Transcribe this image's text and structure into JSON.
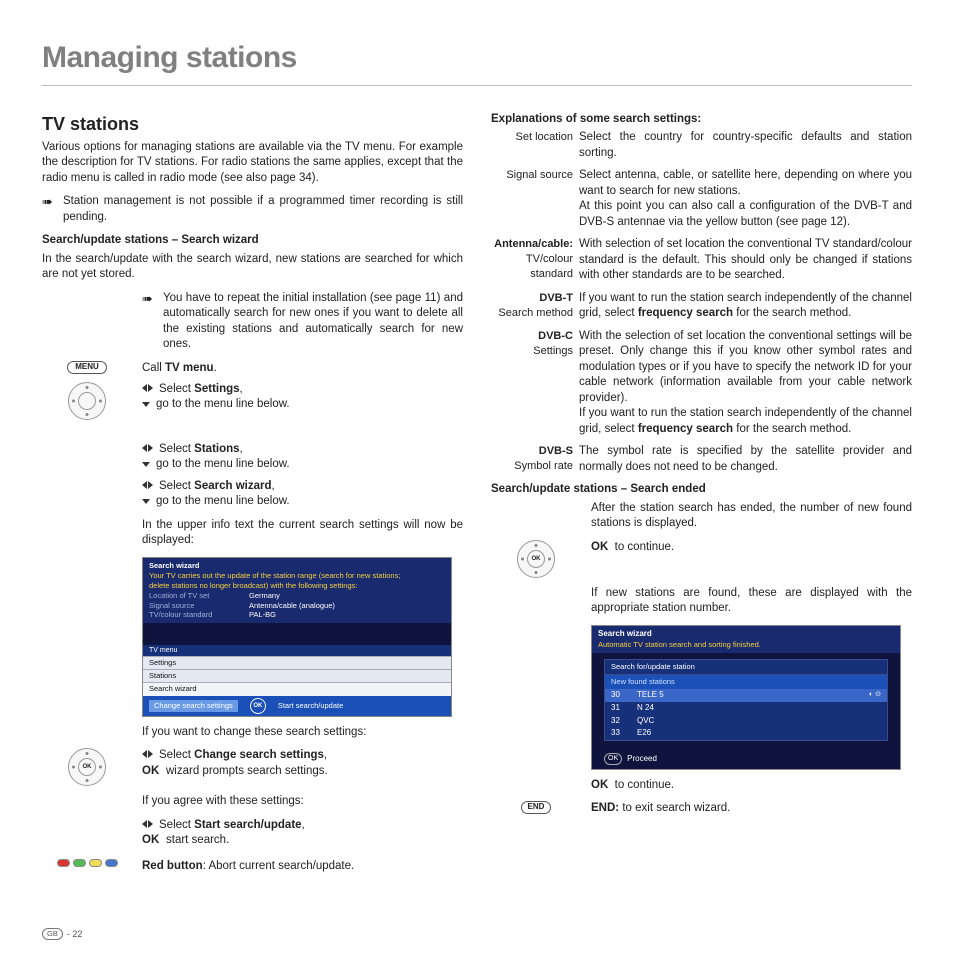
{
  "page": {
    "title": "Managing stations",
    "footer_region": "GB",
    "footer_page": "- 22"
  },
  "left": {
    "h2": "TV stations",
    "intro": "Various options for managing stations are available via the TV menu. For example the description for TV stations. For radio stations the same applies, except that the radio menu is called in radio mode (see also page 34).",
    "note1": "Station management is not possible if a programmed timer recording is still pending.",
    "sub1": "Search/update stations  – Search wizard",
    "sub1_desc": "In the search/update with the search wizard, new stations are searched for which are not yet stored.",
    "note2": "You have to repeat the initial installation (see page 11) and automatically search for new ones if you want to delete all the existing stations and automatically search for new ones.",
    "menu_label": "MENU",
    "call_tv": "Call TV menu.",
    "tv_menu_bold": "TV menu",
    "step1a": "Select Settings,",
    "step1a_bold": "Settings",
    "step_go": "go to the menu line below.",
    "step2a": "Select Stations,",
    "step2a_bold": "Stations",
    "step3a": "Select Search wizard,",
    "step3a_bold": "Search wizard",
    "upper_info": "In the upper info text the current search settings will now be displayed:",
    "screenshot1": {
      "title": "Search wizard",
      "line1": "Your TV carries out the update of the station range (search for new stations;",
      "line2": "delete stations no longer broadcast) with the following settings:",
      "r1_lbl": "Location of TV set",
      "r1_val": "Germany",
      "r2_lbl": "Signal source",
      "r2_val": "Antenna/cable (analogue)",
      "r3_lbl": "TV/colour standard",
      "r3_val": "PAL-BG",
      "menu_head": "TV menu",
      "menu1": "Settings",
      "menu2": "Stations",
      "menu3": "Search wizard",
      "action1": "Change search settings",
      "action2": "Start search/update"
    },
    "if_change": "If you want to change these search settings:",
    "step_change": "Select Change search settings,",
    "step_change_bold": "Change search settings",
    "ok_prompts": "wizard prompts search settings.",
    "ok_label": "OK",
    "if_agree": "If you agree with these settings:",
    "step_start": "Select Start search/update,",
    "step_start_bold": "Start search/update",
    "ok_start": "start search.",
    "red_btn": "Red button",
    "red_desc": ": Abort current search/update."
  },
  "right": {
    "sub1": "Explanations of some search settings:",
    "defs": [
      {
        "term1": "Set location",
        "desc": "Select the country for country-specific defaults and station sorting."
      },
      {
        "term1": "Signal source",
        "desc": "Select antenna, cable, or satellite here, depending on where you want to search for new stations.\nAt this point you can also call a configuration of the DVB-T and DVB-S antennae via the yellow button (see page 12)."
      },
      {
        "term1": "Antenna/cable:",
        "term2": "TV/colour",
        "term3": "standard",
        "desc": "With selection of set location the conventional TV standard/colour standard is the default. This should only be changed if stations with other standards are to be searched."
      },
      {
        "term1": "DVB-T",
        "term2": "Search method",
        "desc": "If you want to run the station search independently of the channel grid, select frequency search for the search method.",
        "bold_in_desc": "frequency search"
      },
      {
        "term1": "DVB-C",
        "term2": "Settings",
        "desc": "With the selection of set location the conventional settings will be preset. Only change this if you know other symbol rates and modulation types or if you have to specify the network ID for your cable network (information available from your cable network provider).\nIf you want to run the station search independently of the channel grid, select frequency search for the search method.",
        "bold_in_desc": "frequency search"
      },
      {
        "term1": "DVB-S",
        "term2": "Symbol rate",
        "desc": "The symbol rate is specified by the satellite provider and normally does not need to be changed."
      }
    ],
    "sub2": "Search/update stations – Search ended",
    "after_search": "After the station search has ended, the number of new found stations is displayed.",
    "ok_continue": "to continue.",
    "ok_label": "OK",
    "new_stations": "If new stations are found, these are displayed with the appropriate station number.",
    "screenshot2": {
      "title": "Search wizard",
      "subtitle": "Automatic TV station search and sorting finished.",
      "tbl_head": "Search for/update station",
      "tbl_sub": "New found stations",
      "rows": [
        {
          "num": "30",
          "name": "TELE 5"
        },
        {
          "num": "31",
          "name": "N 24"
        },
        {
          "num": "32",
          "name": "QVC"
        },
        {
          "num": "33",
          "name": "E26"
        }
      ],
      "proceed": "Proceed"
    },
    "ok_continue2": "to continue.",
    "end_label": "END",
    "end_bold": "END:",
    "end_desc": "to exit search wizard."
  }
}
